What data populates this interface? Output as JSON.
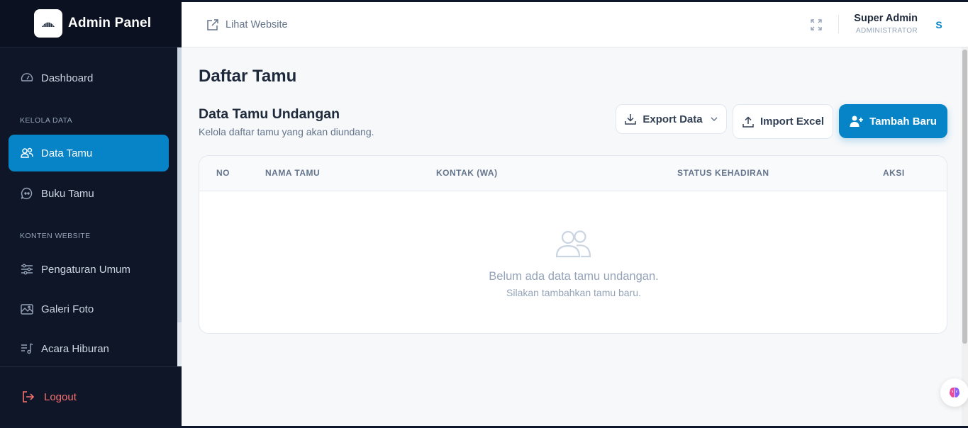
{
  "app": {
    "title": "Admin Panel"
  },
  "sidebar": {
    "items": [
      {
        "label": "Dashboard",
        "icon": "gauge-icon"
      },
      {
        "label": "Data Tamu",
        "icon": "users-icon",
        "active": true
      },
      {
        "label": "Buku Tamu",
        "icon": "chat-quote-icon"
      },
      {
        "label": "Pengaturan Umum",
        "icon": "sliders-icon"
      },
      {
        "label": "Galeri Foto",
        "icon": "images-icon"
      },
      {
        "label": "Acara Hiburan",
        "icon": "music-list-icon"
      }
    ],
    "sections": [
      "KELOLA DATA",
      "KONTEN WEBSITE"
    ],
    "logout": "Logout"
  },
  "header": {
    "visit_link": "Lihat Website",
    "user_name": "Super Admin",
    "user_role": "ADMINISTRATOR",
    "avatar_initial": "S"
  },
  "main": {
    "page_title": "Daftar Tamu",
    "section_title": "Data Tamu Undangan",
    "section_subtitle": "Kelola daftar tamu yang akan diundang.",
    "buttons": {
      "export": "Export Data",
      "import": "Import Excel",
      "add": "Tambah Baru"
    },
    "table": {
      "columns": [
        "NO",
        "NAMA TAMU",
        "KONTAK (WA)",
        "STATUS KEHADIRAN",
        "AKSI"
      ],
      "rows": [],
      "empty_title": "Belum ada data tamu undangan.",
      "empty_subtitle": "Silakan tambahkan tamu baru."
    }
  },
  "colors": {
    "accent": "#0784c8",
    "sidebar_bg": "#0f1628",
    "logout": "#f87171"
  }
}
